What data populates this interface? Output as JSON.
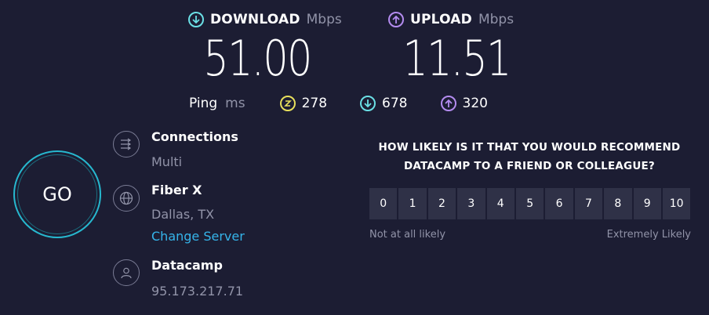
{
  "download": {
    "label": "DOWNLOAD",
    "unit": "Mbps",
    "value": "51.00",
    "icon": "download-arrow-icon",
    "color": "#6be0e6"
  },
  "upload": {
    "label": "UPLOAD",
    "unit": "Mbps",
    "value": "11.51",
    "icon": "upload-arrow-icon",
    "color": "#b48cf0"
  },
  "ping": {
    "label": "Ping",
    "unit": "ms",
    "idle": {
      "value": "278",
      "icon": "ping-idle-icon",
      "color": "#e8e05c"
    },
    "down": {
      "value": "678",
      "icon": "ping-download-icon",
      "color": "#6be0e6"
    },
    "up": {
      "value": "320",
      "icon": "ping-upload-icon",
      "color": "#b48cf0"
    }
  },
  "go": {
    "label": "GO",
    "color": "#27b8cf"
  },
  "connections": {
    "title": "Connections",
    "value": "Multi",
    "icon": "connections-icon"
  },
  "server": {
    "title": "Fiber X",
    "location": "Dallas, TX",
    "change_label": "Change Server",
    "icon": "globe-icon"
  },
  "provider": {
    "title": "Datacamp",
    "ip": "95.173.217.71",
    "icon": "user-icon"
  },
  "survey": {
    "question_line1": "HOW LIKELY IS IT THAT YOU WOULD RECOMMEND",
    "question_line2": "DATACAMP TO A FRIEND OR COLLEAGUE?",
    "scale": [
      "0",
      "1",
      "2",
      "3",
      "4",
      "5",
      "6",
      "7",
      "8",
      "9",
      "10"
    ],
    "low_label": "Not at all likely",
    "high_label": "Extremely Likely"
  }
}
